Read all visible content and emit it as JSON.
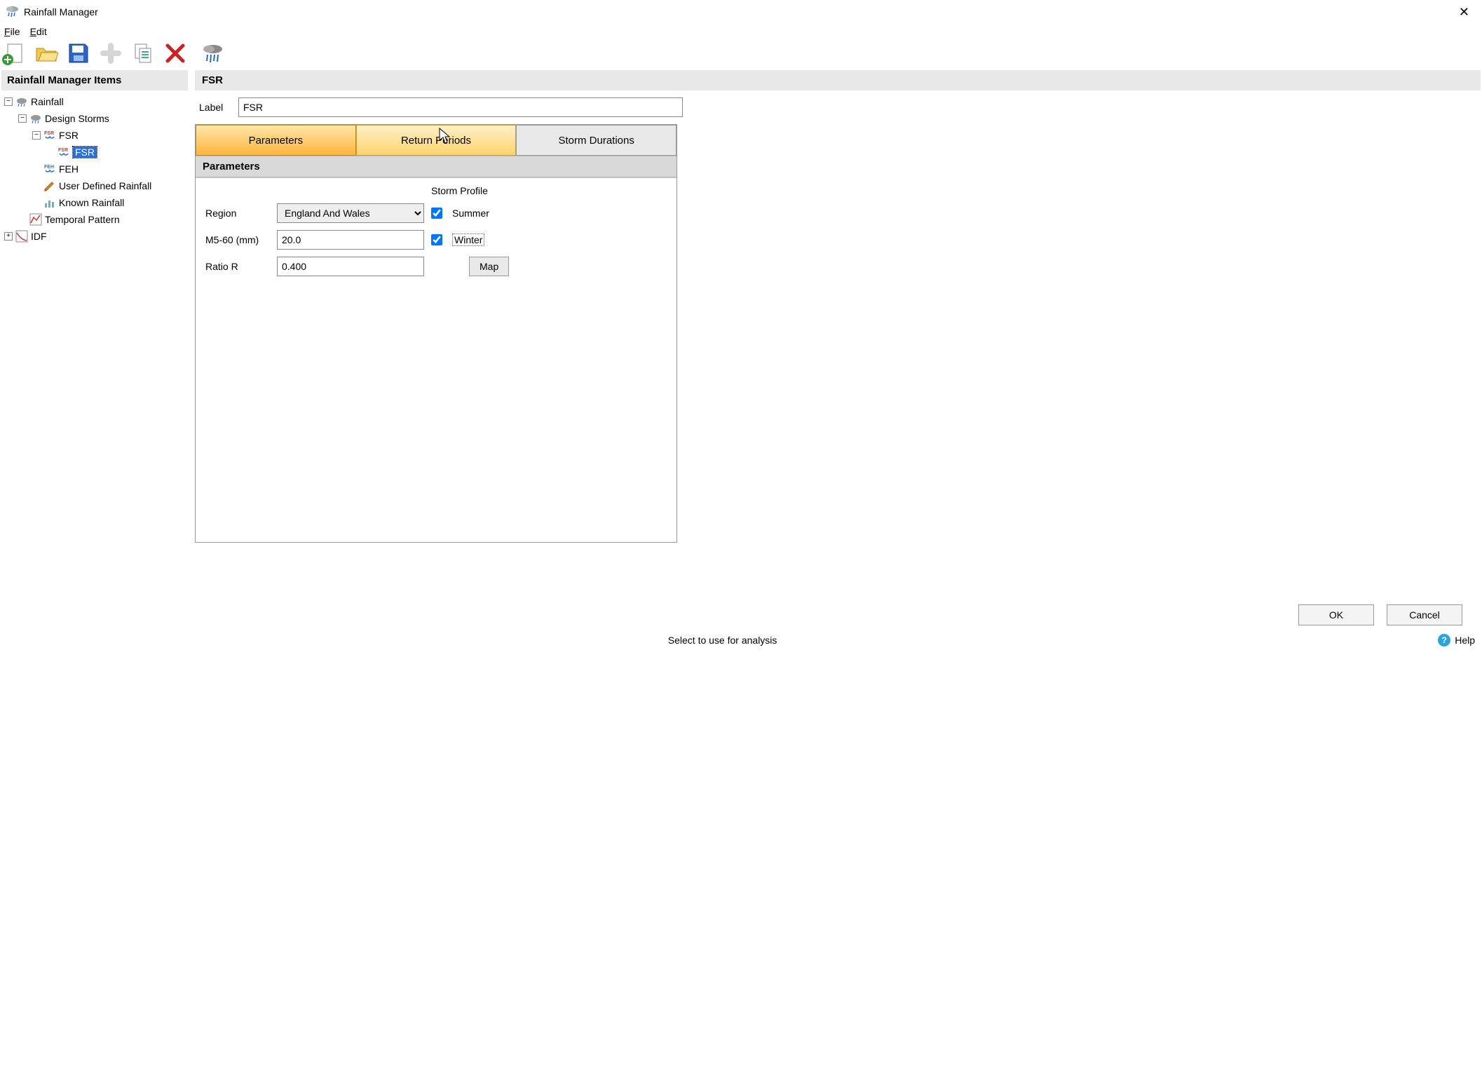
{
  "window": {
    "title": "Rainfall Manager"
  },
  "menu": {
    "file": "File",
    "edit": "Edit"
  },
  "sidebar": {
    "header": "Rainfall Manager Items",
    "tree": {
      "rainfall": "Rainfall",
      "design_storms": "Design Storms",
      "fsr_parent": "FSR",
      "fsr_selected": "FSR",
      "feh": "FEH",
      "user_defined": "User Defined Rainfall",
      "known": "Known Rainfall",
      "temporal": "Temporal Pattern",
      "idf": "IDF"
    }
  },
  "main": {
    "header": "FSR",
    "label_caption": "Label",
    "label_value": "FSR",
    "tabs": {
      "parameters": "Parameters",
      "return_periods": "Return Periods",
      "storm_durations": "Storm Durations"
    },
    "section_title": "Parameters",
    "form": {
      "storm_profile_hdr": "Storm Profile",
      "region_label": "Region",
      "region_value": "England And Wales",
      "m560_label": "M5-60 (mm)",
      "m560_value": "20.0",
      "ratio_label": "Ratio R",
      "ratio_value": "0.400",
      "summer_label": "Summer",
      "winter_label": "Winter",
      "summer_checked": true,
      "winter_checked": true,
      "map_button": "Map"
    }
  },
  "footer": {
    "ok": "OK",
    "cancel": "Cancel",
    "status": "Select to use for analysis",
    "help": "Help"
  }
}
